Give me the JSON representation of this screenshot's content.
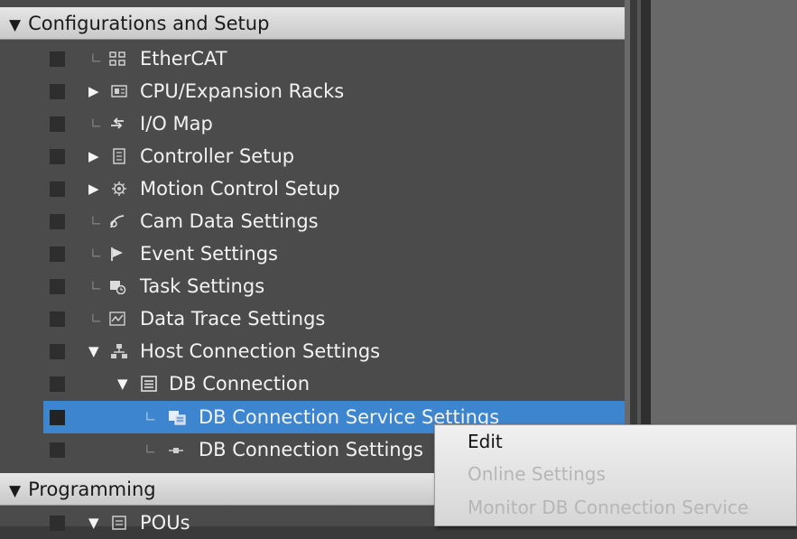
{
  "tree": {
    "configurations_header": {
      "toggle": "▼",
      "label": "Configurations and Setup"
    },
    "items": [
      {
        "label": "EtherCAT",
        "toggle": "",
        "icon": "ethercat-icon"
      },
      {
        "label": "CPU/Expansion Racks",
        "toggle": "▶",
        "icon": "cpu-rack-icon"
      },
      {
        "label": "I/O Map",
        "toggle": "",
        "icon": "io-map-icon"
      },
      {
        "label": "Controller Setup",
        "toggle": "▶",
        "icon": "controller-setup-icon"
      },
      {
        "label": "Motion Control Setup",
        "toggle": "▶",
        "icon": "gear-icon"
      },
      {
        "label": "Cam Data Settings",
        "toggle": "",
        "icon": "cam-data-icon"
      },
      {
        "label": "Event Settings",
        "toggle": "",
        "icon": "event-flag-icon"
      },
      {
        "label": "Task Settings",
        "toggle": "",
        "icon": "task-icon"
      },
      {
        "label": "Data Trace Settings",
        "toggle": "",
        "icon": "data-trace-icon"
      },
      {
        "label": "Host Connection Settings",
        "toggle": "▼",
        "icon": "host-connection-icon"
      },
      {
        "label": "DB Connection",
        "toggle": "▼",
        "icon": "db-connection-icon"
      },
      {
        "label": "DB Connection Service Settings",
        "toggle": "",
        "icon": "db-service-icon"
      },
      {
        "label": "DB Connection Settings",
        "toggle": "",
        "icon": "db-settings-icon"
      }
    ],
    "programming_header": {
      "toggle": "▼",
      "label": "Programming"
    },
    "pous": {
      "toggle": "▼",
      "label": "POUs"
    }
  },
  "context_menu": {
    "items": [
      {
        "label": "Edit",
        "enabled": true
      },
      {
        "label": "Online Settings",
        "enabled": false
      },
      {
        "label": "Monitor DB Connection Service",
        "enabled": false
      }
    ]
  },
  "colors": {
    "selection": "#3d86cf",
    "tree_bg": "#4b4b4b",
    "header_bg": "#d9d9d9",
    "menu_bg": "#e6e6e6",
    "disabled_text": "#b6b6b6"
  }
}
